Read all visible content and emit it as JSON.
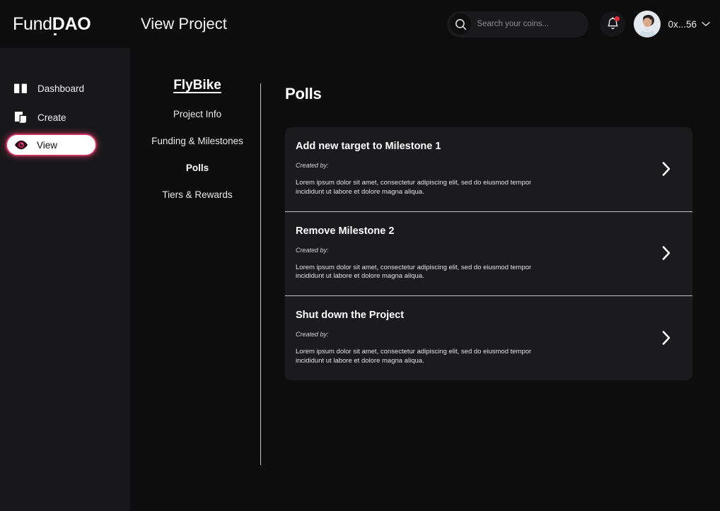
{
  "brand": {
    "logo_light": "Fund",
    "logo_bold": "DAO"
  },
  "sidebar": {
    "items": [
      {
        "label": "Dashboard",
        "icon": "book-icon",
        "active": false
      },
      {
        "label": "Create",
        "icon": "scroll-icon",
        "active": false
      },
      {
        "label": "View",
        "icon": "eye-icon",
        "active": true
      }
    ]
  },
  "header": {
    "title": "View Project",
    "search": {
      "placeholder": "Search your coins...",
      "value": "",
      "icon": "search-icon"
    },
    "notifications": {
      "icon": "bell-icon",
      "has_unread": true
    },
    "account": {
      "address": "0x...56",
      "avatar": "user-avatar",
      "chevron": "chevron-down-icon"
    }
  },
  "project_nav": {
    "project_name": "FlyBike",
    "items": [
      {
        "label": "Project Info",
        "active": false
      },
      {
        "label": "Funding & Milestones",
        "active": false
      },
      {
        "label": "Polls",
        "active": true
      },
      {
        "label": "Tiers & Rewards",
        "active": false
      }
    ]
  },
  "main": {
    "heading": "Polls",
    "created_by_label": "Created by:",
    "polls": [
      {
        "title": "Add new target to Milestone 1",
        "created_by": "Created by:",
        "description": "Lorem ipsum dolor sit amet, consectetur adipiscing elit, sed do eiusmod tempor incididunt ut labore et dolore magna aliqua."
      },
      {
        "title": "Remove Milestone 2",
        "created_by": "Created by:",
        "description": "Lorem ipsum dolor sit amet, consectetur adipiscing elit, sed do eiusmod tempor incididunt ut labore et dolore magna aliqua."
      },
      {
        "title": "Shut down the Project",
        "created_by": "Created by:",
        "description": "Lorem ipsum dolor sit amet, consectetur adipiscing elit, sed do eiusmod tempor incididunt ut labore et dolore magna aliqua."
      }
    ]
  },
  "colors": {
    "accent": "#e23a6a",
    "page_bg": "#0d0d0d",
    "sidebar_bg": "#18181a",
    "card_bg": "#1b1b1d",
    "badge_red": "#e32b3c",
    "divider": "#c5c5c8"
  }
}
